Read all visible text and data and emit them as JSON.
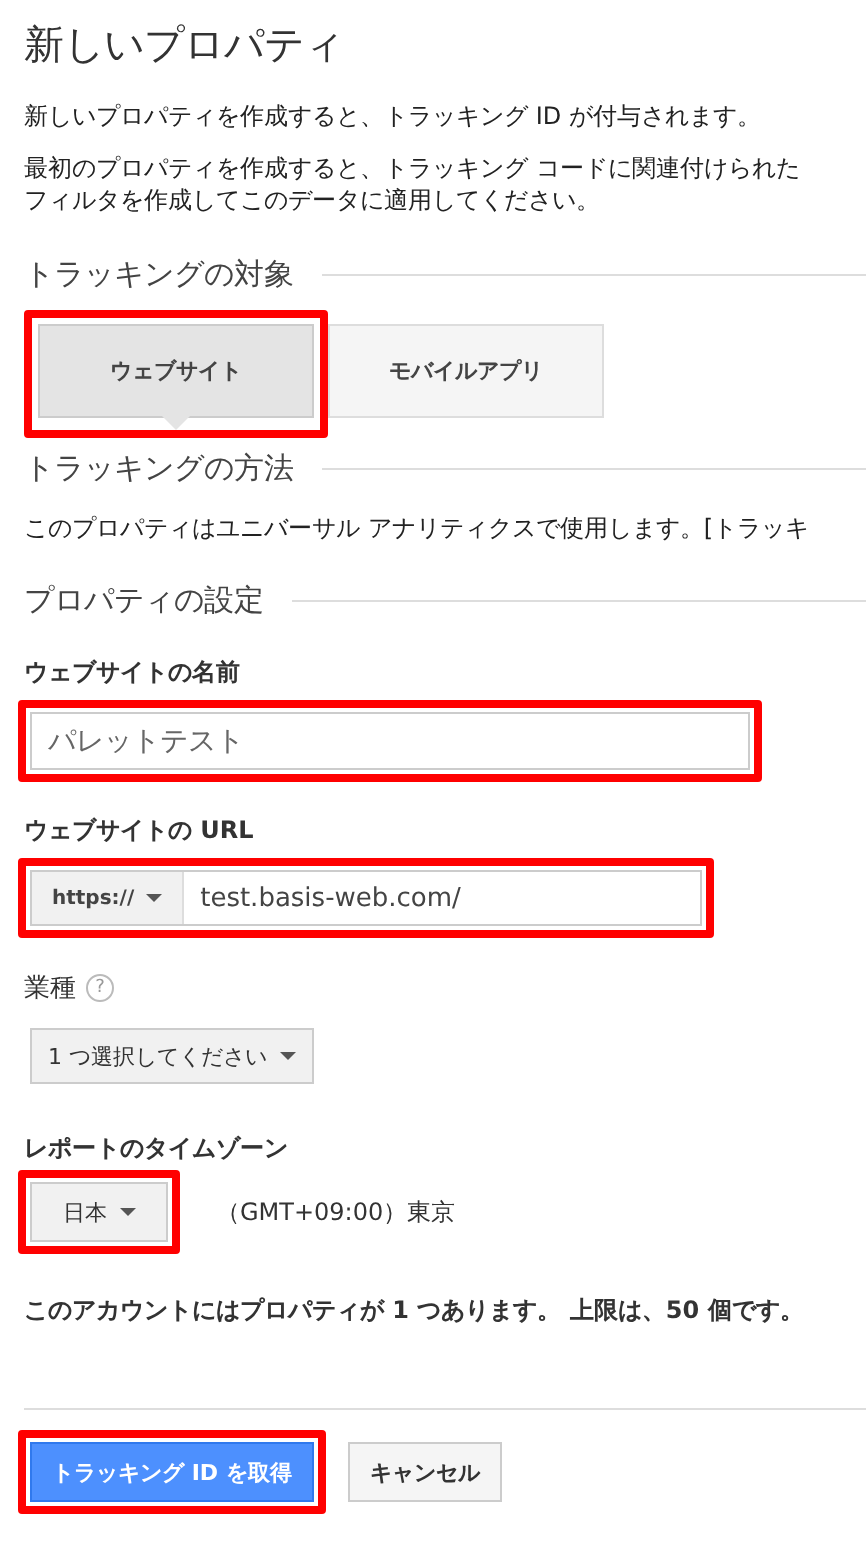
{
  "title": "新しいプロパティ",
  "intro": [
    "新しいプロパティを作成すると、トラッキング ID が付与されます。",
    "最初のプロパティを作成すると、トラッキング コードに関連付けられた",
    "フィルタを作成してこのデータに適用してください。"
  ],
  "target_section": {
    "heading": "トラッキングの対象",
    "tabs": [
      {
        "label": "ウェブサイト",
        "selected": true,
        "highlighted": true
      },
      {
        "label": "モバイルアプリ",
        "selected": false,
        "highlighted": false
      }
    ]
  },
  "method_section": {
    "heading": "トラッキングの方法",
    "text": "このプロパティはユニバーサル アナリティクスで使用します。[トラッキ"
  },
  "settings_section": {
    "heading": "プロパティの設定",
    "name_field": {
      "label": "ウェブサイトの名前",
      "placeholder": "パレットテスト",
      "highlighted": true
    },
    "url_field": {
      "label": "ウェブサイトの URL",
      "protocol": "https://",
      "value": "test.basis-web.com/",
      "highlighted": true
    },
    "industry": {
      "label": "業種",
      "help": "?",
      "dropdown": "1 つ選択してください",
      "highlighted": false
    },
    "timezone": {
      "label": "レポートのタイムゾーン",
      "country": "日本",
      "zone": "（GMT+09:00）東京",
      "highlighted": true
    },
    "limit_text": "このアカウントにはプロパティが 1 つあります。 上限は、50 個です。"
  },
  "buttons": [
    {
      "label": "トラッキング ID を取得",
      "kind": "primary",
      "highlighted": true
    },
    {
      "label": "キャンセル",
      "kind": "secondary",
      "highlighted": false
    }
  ]
}
